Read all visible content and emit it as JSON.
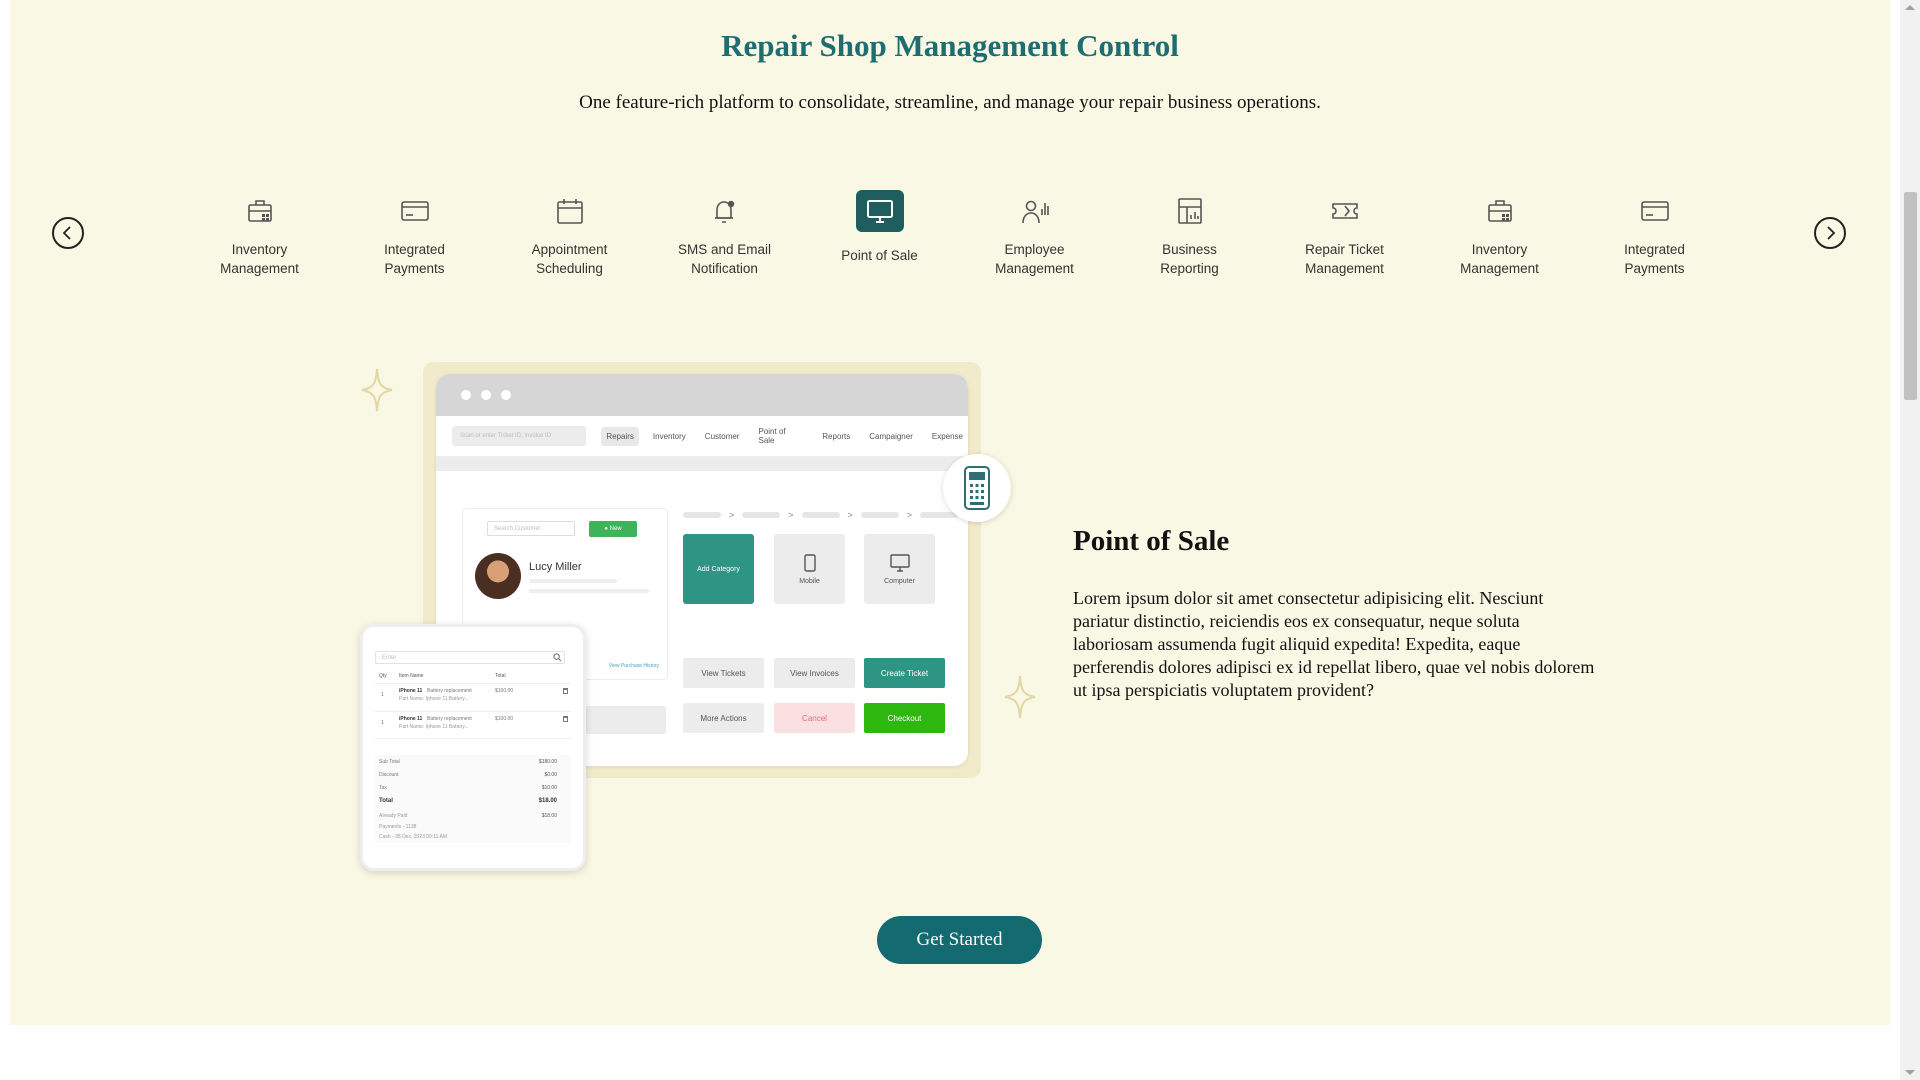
{
  "header": {
    "title": "Repair Shop Management Control",
    "subtitle": "One feature-rich platform to consolidate, streamline, and manage your repair business operations."
  },
  "carousel": {
    "prev_icon": "chevron-left-icon",
    "next_icon": "chevron-right-icon",
    "features": [
      {
        "label": "Inventory\nManagement",
        "icon": "briefcase-grid-icon",
        "active": false
      },
      {
        "label": "Integrated\nPayments",
        "icon": "credit-card-icon",
        "active": false
      },
      {
        "label": "Appointment\nScheduling",
        "icon": "calendar-icon",
        "active": false
      },
      {
        "label": "SMS and Email\nNotification",
        "icon": "bell-icon",
        "active": false
      },
      {
        "label": "Point of Sale",
        "icon": "monitor-icon",
        "active": true
      },
      {
        "label": "Employee\nManagement",
        "icon": "employee-icon",
        "active": false
      },
      {
        "label": "Business\nReporting",
        "icon": "report-icon",
        "active": false
      },
      {
        "label": "Repair Ticket\nManagement",
        "icon": "ticket-icon",
        "active": false
      },
      {
        "label": "Inventory\nManagement",
        "icon": "briefcase-grid-icon",
        "active": false
      },
      {
        "label": "Integrated\nPayments",
        "icon": "credit-card-icon",
        "active": false
      }
    ]
  },
  "illustration": {
    "search_placeholder": "Scan or enter Ticket ID, Invoice ID",
    "nav": [
      "Repairs",
      "Inventory",
      "Customer",
      "Point of Sale",
      "Reports",
      "Campaigner",
      "Expense"
    ],
    "customer_search": "Search Customer",
    "new_label": "New",
    "customer_name": "Lucy Miller",
    "view_history": "View Purchase History",
    "tiles": [
      "Add Category",
      "Mobile",
      "Computer"
    ],
    "actions": [
      "View Tickets",
      "View Invoices",
      "Create Ticket",
      "More Actions",
      "Cancel",
      "Checkout"
    ],
    "phone": {
      "enter_placeholder": "Enter",
      "columns": [
        "Qty",
        "Item Name",
        "Total"
      ],
      "items": [
        {
          "qty": "1",
          "name": "iPhone 11",
          "desc": "Battery replacement",
          "sub": "Part Name: Iphone 11 Battery...",
          "total": "$100.00"
        },
        {
          "qty": "1",
          "name": "iPhone 11",
          "desc": "Battery replacement",
          "sub": "Part Name: Iphone 11 Battery...",
          "total": "$100.00"
        }
      ],
      "summary": [
        {
          "label": "Sub Total",
          "value": "$180.00"
        },
        {
          "label": "Discount",
          "value": "$0.00"
        },
        {
          "label": "Tax",
          "value": "$10.00"
        },
        {
          "label": "Total",
          "value": "$18.00"
        }
      ],
      "already_paid_label": "Already Paid",
      "already_paid_value": "$18.00",
      "payments_label": "Payments - 1138",
      "cash_label": "Cash - 28 Dec, 2023 09:11 AM"
    }
  },
  "detail": {
    "title": "Point of Sale",
    "description": "Lorem ipsum dolor sit amet consectetur adipisicing elit. Nesciunt pariatur distinctio, reiciendis eos ex consequatur, neque soluta laboriosam assumenda fugit aliquid expedita! Expedita, eaque perferendis dolores adipisci ex id repellat libero, quae vel nobis dolorem ut ipsa perspiciatis voluptatem provident?"
  },
  "cta": {
    "label": "Get Started"
  },
  "colors": {
    "accent": "#1e6e71",
    "background": "#f8f8e4",
    "active_icon_bg": "#1f5e5e",
    "checkout": "#2eb80f"
  }
}
